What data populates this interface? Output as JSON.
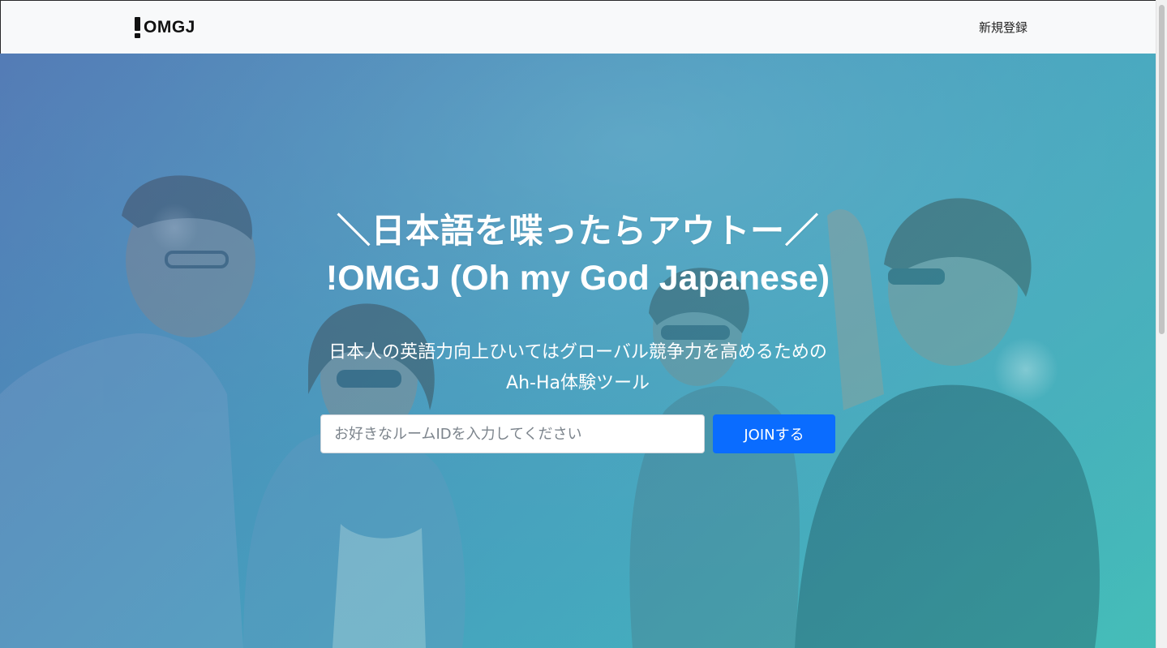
{
  "navbar": {
    "brand": "OMGJ",
    "signup_link": "新規登録"
  },
  "hero": {
    "headline_line1": "＼日本語を喋ったらアウトー／",
    "headline_line2": "!OMGJ (Oh my God Japanese)",
    "subtitle_line1": "日本人の英語力向上ひいてはグローバル競争力を高めるための",
    "subtitle_line2": "Ah-Ha体験ツール",
    "room_input_value": "",
    "room_input_placeholder": "お好きなルームIDを入力してください",
    "join_button_label": "JOINする"
  },
  "colors": {
    "navbar_bg": "#f8f9fa",
    "primary_button": "#0a6cff",
    "hero_overlay_start": "#5570b4",
    "hero_overlay_end": "#3cbeb9"
  },
  "icons": {
    "brand_logo": "exclamation-logo-icon",
    "hero_background": "group-of-friends-photo"
  }
}
